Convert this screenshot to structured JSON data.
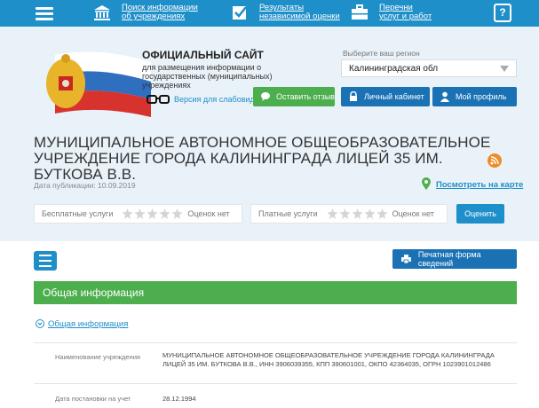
{
  "topnav": {
    "items": [
      {
        "label": "Поиск информации\nоб учреждениях",
        "icon": "building-icon"
      },
      {
        "label": "Результаты\nнезависимой оценки",
        "icon": "checkbox-icon"
      },
      {
        "label": "Перечни\nуслуг и работ",
        "icon": "briefcase-icon"
      }
    ],
    "help": "?"
  },
  "header": {
    "site_title": "ОФИЦИАЛЬНЫЙ САЙТ",
    "site_subtitle": "для размещения информации о государственных (муниципальных) учреждениях",
    "low_vision": "Версия для слабовидящих",
    "region_label": "Выберите ваш регион",
    "region_value": "Калининградская обл",
    "feedback_button": "Оставить отзыв",
    "cabinet_button": "Личный кабинет",
    "profile_button": "Мой профиль"
  },
  "org": {
    "title": "МУНИЦИПАЛЬНОЕ АВТОНОМНОЕ ОБЩЕОБРАЗОВАТЕЛЬНОЕ УЧРЕЖДЕНИЕ ГОРОДА КАЛИНИНГРАДА ЛИЦЕЙ 35 ИМ. БУТКОВА В.В.",
    "publication_date": "Дата публикации: 10.09.2019",
    "map_link": "Посмотреть на карте"
  },
  "ratings": {
    "free_label": "Бесплатные услуги",
    "free_value": "Оценок нет",
    "paid_label": "Платные услуги",
    "paid_value": "Оценок нет",
    "rate_button": "Оценить"
  },
  "main": {
    "print_button": "Печатная форма сведений",
    "section_title": "Общая информация",
    "sub_link": "Общая информация",
    "rows": [
      {
        "key": "Наименование учреждения",
        "value": "МУНИЦИПАЛЬНОЕ АВТОНОМНОЕ ОБЩЕОБРАЗОВАТЕЛЬНОЕ УЧРЕЖДЕНИЕ ГОРОДА КАЛИНИНГРАДА ЛИЦЕЙ 35 ИМ. БУТКОВА В.В., ИНН 3906039355, КПП 390601001, ОКПО 42364035, ОГРН 1023901012486"
      },
      {
        "key": "Дата постановки на учет",
        "value": "28.12.1994"
      }
    ]
  },
  "colors": {
    "nav_blue": "#1f8fc9",
    "dark_blue": "#1a72b4",
    "green": "#4cae4c",
    "rss_orange": "#f08a24"
  }
}
